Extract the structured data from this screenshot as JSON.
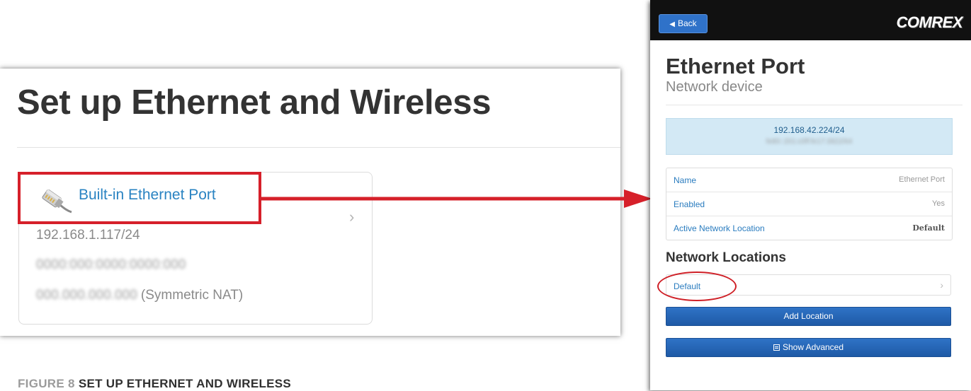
{
  "left": {
    "title": "Set up Ethernet and Wireless",
    "card": {
      "title": "Built-in Ethernet Port",
      "ipv4": "192.168.1.117/24",
      "nat_suffix": "(Symmetric NAT)"
    }
  },
  "caption": {
    "figure_number": "FIGURE 8",
    "text": "SET UP ETHERNET AND WIRELESS"
  },
  "phone": {
    "back_label": "Back",
    "brand": "COMREX",
    "title": "Ethernet Port",
    "subtitle": "Network device",
    "address": {
      "ipv4": "192.168.42.224/24"
    },
    "properties": [
      {
        "label": "Name",
        "value": "Ethernet Port"
      },
      {
        "label": "Enabled",
        "value": "Yes"
      },
      {
        "label": "Active Network Location",
        "value": "Default"
      }
    ],
    "locations_heading": "Network Locations",
    "locations": [
      {
        "label": "Default"
      }
    ],
    "add_location_label": "Add Location",
    "show_advanced_label": "Show Advanced"
  },
  "colors": {
    "highlight": "#d6202a",
    "link": "#2a83c2",
    "button": "#2f72c9",
    "info_box": "#d3e9f5"
  },
  "icons": [
    "ethernet-plug-icon",
    "chevron-right-icon",
    "chevron-left-icon",
    "list-icon"
  ]
}
